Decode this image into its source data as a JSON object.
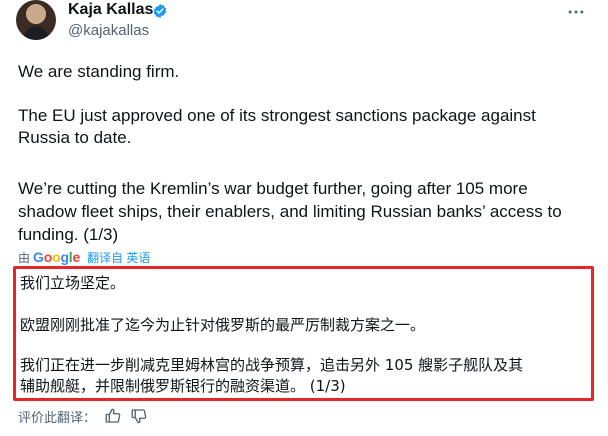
{
  "author": {
    "display_name": "Kaja Kallas",
    "handle": "@kajakallas"
  },
  "tweet": {
    "paragraphs": [
      [
        "We are standing firm."
      ],
      [
        "The EU just approved one of its strongest sanctions package against",
        "Russia to date."
      ],
      [
        "We’re cutting the Kremlin’s war budget further, going after 105 more",
        "shadow fleet ships, their enablers, and limiting Russian banks’ access to",
        "funding. (1/3)"
      ]
    ]
  },
  "translation": {
    "by_prefix": "由",
    "provider_letters": [
      "G",
      "o",
      "o",
      "g",
      "l",
      "e"
    ],
    "link_label": "翻译自 英语",
    "lines": [
      "我们立场坚定。",
      "欧盟刚刚批准了迄今为止针对俄罗斯的最严厉制裁方案之一。",
      "我们正在进一步削减克里姆林宫的战争预算，追击另外 105 艘影子舰队及其",
      "辅助舰艇，并限制俄罗斯银行的融资渠道。 (1/3)"
    ],
    "rate_label": "评价此翻译："
  },
  "icons": {
    "verified": "verified-badge-icon",
    "more": "more-options-icon",
    "thumbs_up": "thumbs-up-icon",
    "thumbs_down": "thumbs-down-icon"
  },
  "colors": {
    "text": "#0f1419",
    "secondary": "#536471",
    "link": "#1d9bf0",
    "highlight_border": "#e8252b"
  }
}
